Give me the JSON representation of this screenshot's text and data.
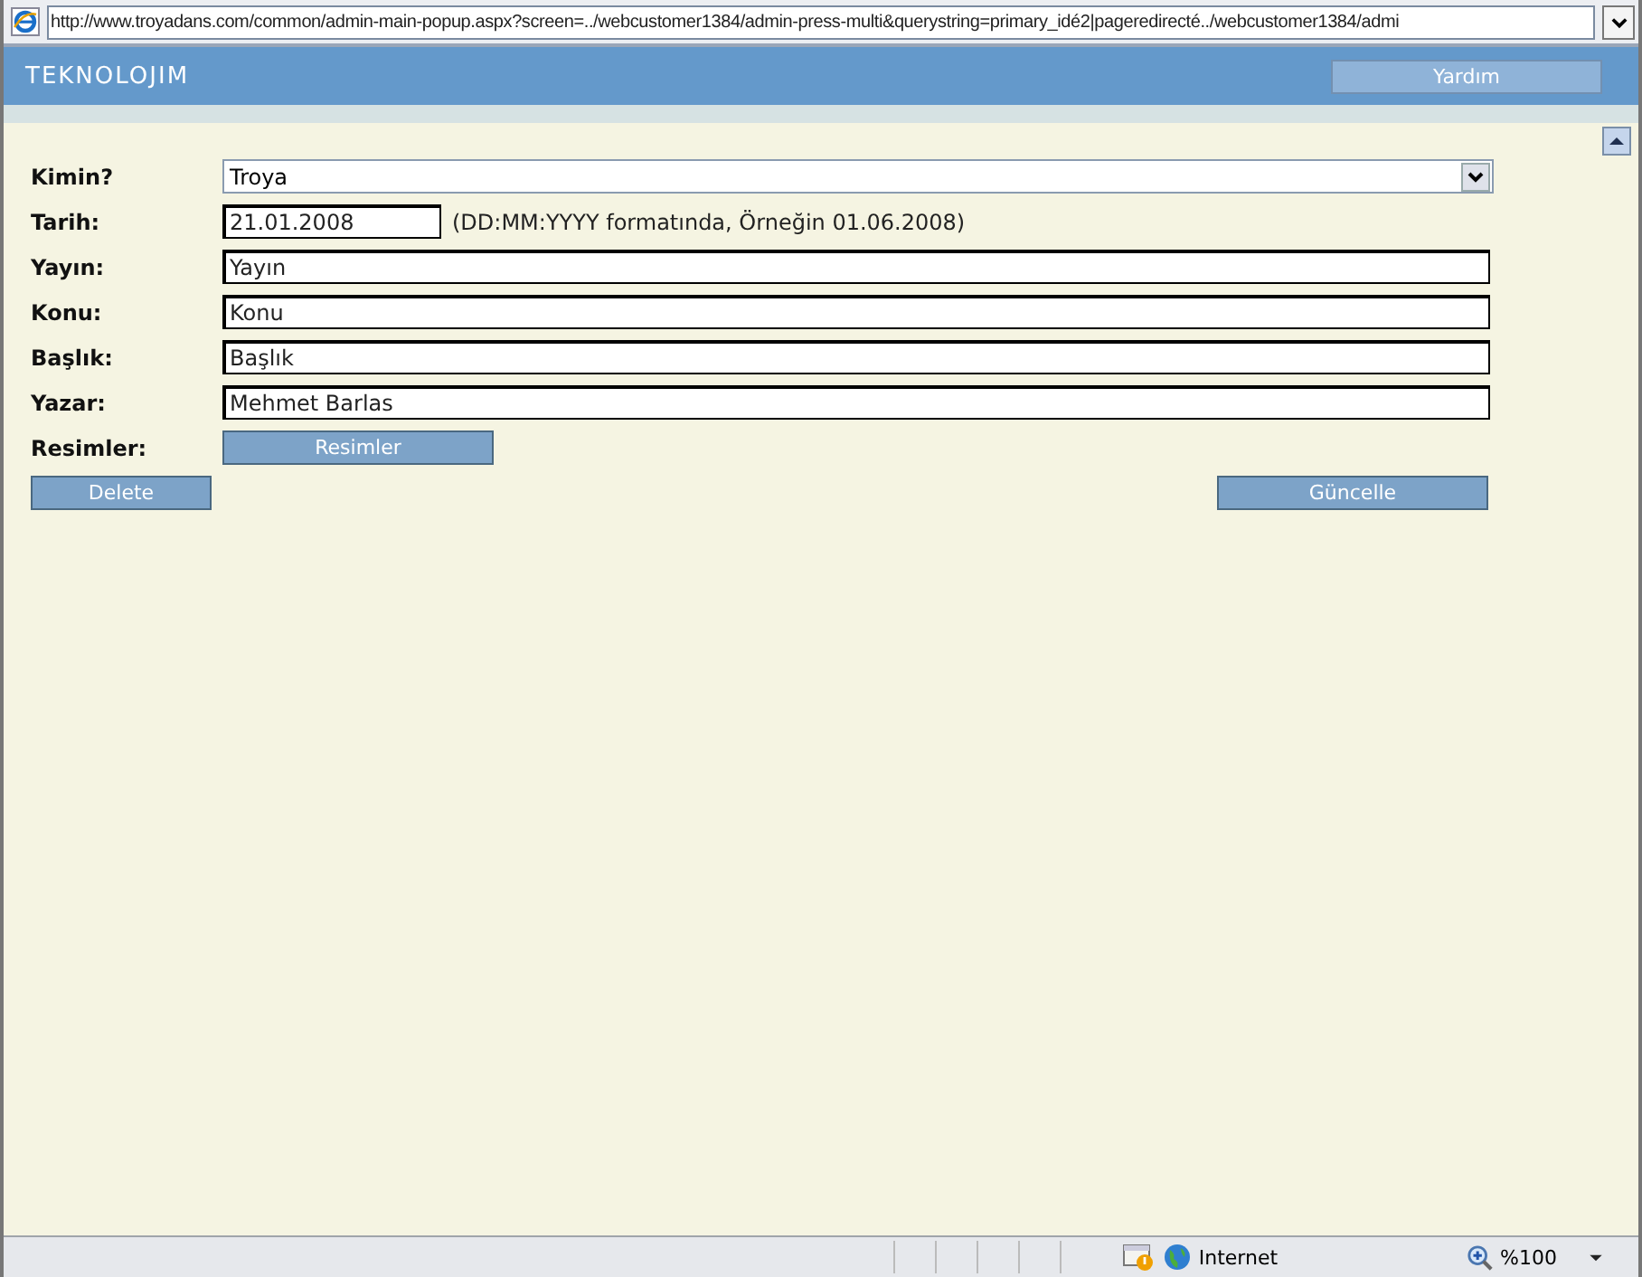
{
  "address_bar": {
    "url": "http://www.troyadans.com/common/admin-main-popup.aspx?screen=../webcustomer1384/admin-press-multi&querystring=primary_idé2|pageredirecté../webcustomer1384/admi"
  },
  "header": {
    "logo": "TEKNOLOJIM",
    "help_button": "Yardım"
  },
  "form": [
    {
      "kind": "select",
      "label": "Kimin?",
      "value": "Troya"
    },
    {
      "kind": "date",
      "label": "Tarih:",
      "value": "21.01.2008",
      "hint": "(DD:MM:YYYY formatında, Örneğin 01.06.2008)"
    },
    {
      "kind": "text",
      "label": "Yayın:",
      "value": "Yayın"
    },
    {
      "kind": "text",
      "label": "Konu:",
      "value": "Konu"
    },
    {
      "kind": "text",
      "label": "Başlık:",
      "value": "Başlık"
    },
    {
      "kind": "text",
      "label": "Yazar:",
      "value": "Mehmet Barlas"
    },
    {
      "kind": "button",
      "label": "Resimler:",
      "value": "Resimler"
    }
  ],
  "actions": {
    "delete": "Delete",
    "update": "Güncelle"
  },
  "status_bar": {
    "zone": "Internet",
    "zoom": "%100"
  }
}
